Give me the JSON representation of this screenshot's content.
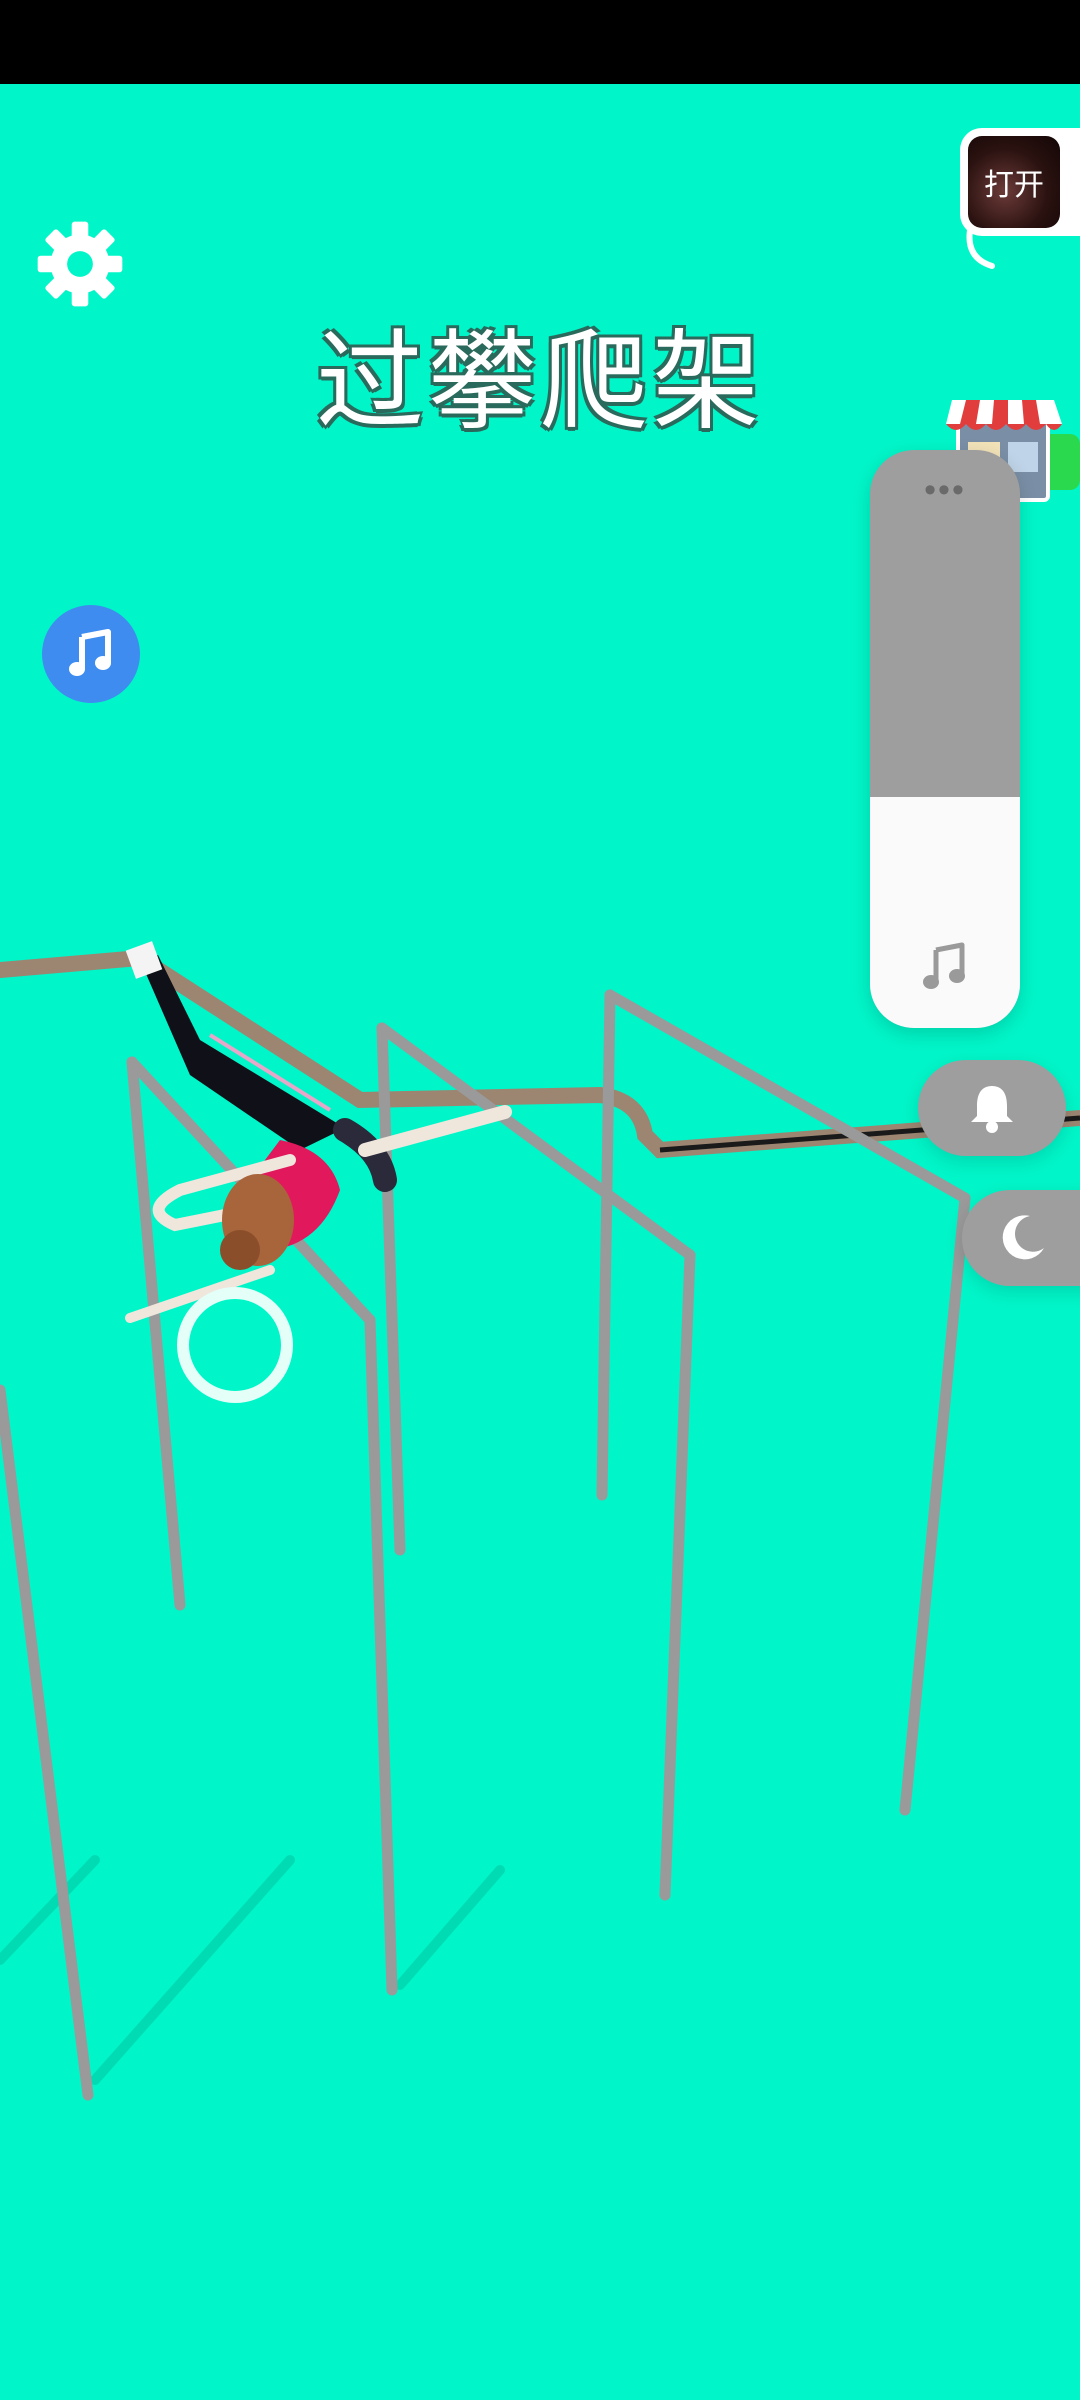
{
  "game": {
    "title": "过攀爬架",
    "open_label": "打开"
  },
  "volume": {
    "level": 0.4
  },
  "icons": {
    "settings": "gear-icon",
    "music": "music-note-icon",
    "shop": "shop-icon",
    "bell": "bell-icon",
    "moon": "moon-icon"
  },
  "colors": {
    "background": "#00F5C8",
    "music_button": "#3F8CF0",
    "panel_gray": "#9E9E9E"
  }
}
